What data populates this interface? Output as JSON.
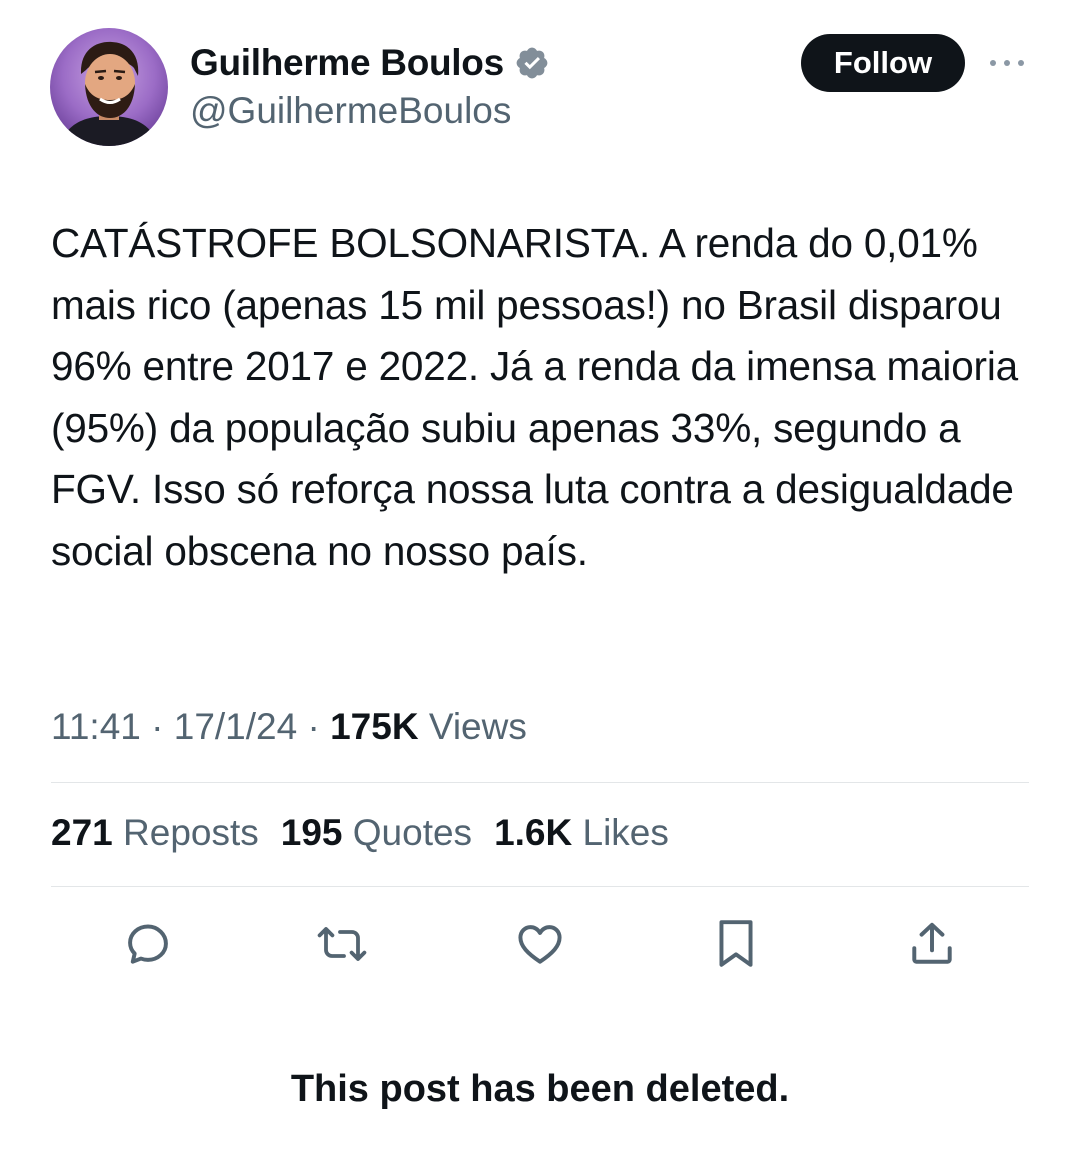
{
  "author": {
    "display_name": "Guilherme Boulos",
    "handle": "@GuilhermeBoulos",
    "verified": true,
    "avatar_icon": "portrait-avatar"
  },
  "header": {
    "follow_label": "Follow",
    "more_icon": "ellipsis-icon"
  },
  "post": {
    "text": "CATÁSTROFE BOLSONARISTA. A renda do 0,01% mais rico (apenas 15 mil pessoas!) no Brasil disparou 96% entre 2017 e 2022. Já a renda da imensa maioria (95%) da população subiu apenas 33%, segundo a FGV. Isso só reforça nossa luta contra a desigualdade social obscena no nosso país.",
    "time": "11:41",
    "date": "17/1/24",
    "separator": " · ",
    "views_count": "175K",
    "views_label": "Views"
  },
  "stats": {
    "reposts_count": "271",
    "reposts_label": "Reposts",
    "quotes_count": "195",
    "quotes_label": "Quotes",
    "likes_count": "1.6K",
    "likes_label": "Likes"
  },
  "actions": [
    "reply-icon",
    "repost-icon",
    "like-icon",
    "bookmark-icon",
    "share-icon"
  ],
  "notice": "This post has been deleted.",
  "colors": {
    "text_primary": "#0f1419",
    "text_secondary": "#536471",
    "verified_badge": "#828e99",
    "divider": "#e3e6e8",
    "follow_bg": "#0f1419",
    "follow_text": "#ffffff",
    "avatar_bg": "#8a5bb5"
  }
}
